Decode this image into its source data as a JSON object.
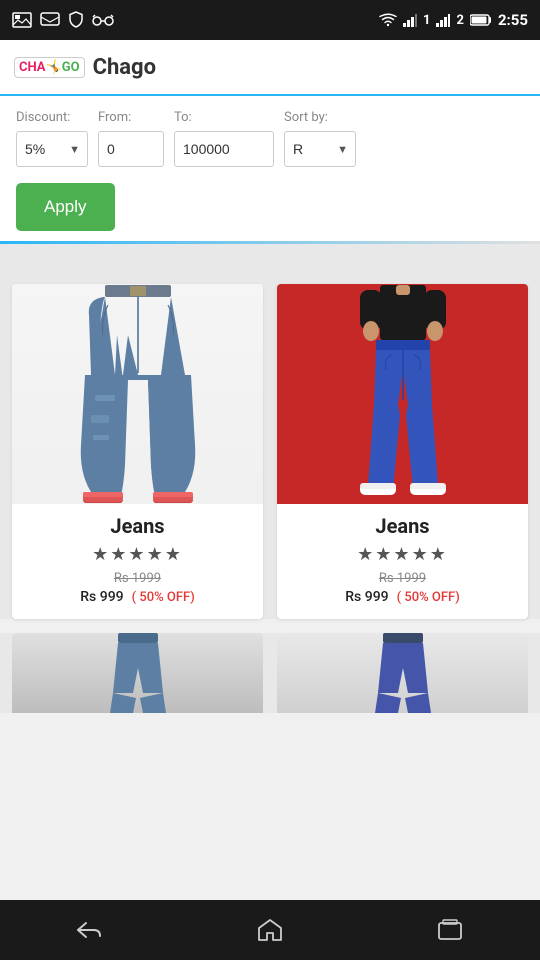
{
  "statusBar": {
    "time": "2:55",
    "icons": [
      "gallery",
      "message",
      "shield",
      "spy"
    ]
  },
  "header": {
    "logo": "Chago",
    "logoPrefix": "CHA",
    "logoSuffix": "GO"
  },
  "filters": {
    "discountLabel": "Discount:",
    "fromLabel": "From:",
    "toLabel": "To:",
    "sortByLabel": "Sort by:",
    "discountValue": "5%",
    "fromValue": "0",
    "toValue": "100000",
    "sortByValue": "R",
    "applyLabel": "Apply"
  },
  "products": [
    {
      "name": "Jeans",
      "stars": "★★★★★",
      "originalPrice": "Rs 1999",
      "salePrice": "Rs 999",
      "offBadge": "( 50% OFF)",
      "bg": "white"
    },
    {
      "name": "Jeans",
      "stars": "★★★★★",
      "originalPrice": "Rs 1999",
      "salePrice": "Rs 999",
      "offBadge": "( 50% OFF)",
      "bg": "red"
    }
  ],
  "nav": {
    "back": "←",
    "home": "⌂",
    "recent": "▭"
  }
}
